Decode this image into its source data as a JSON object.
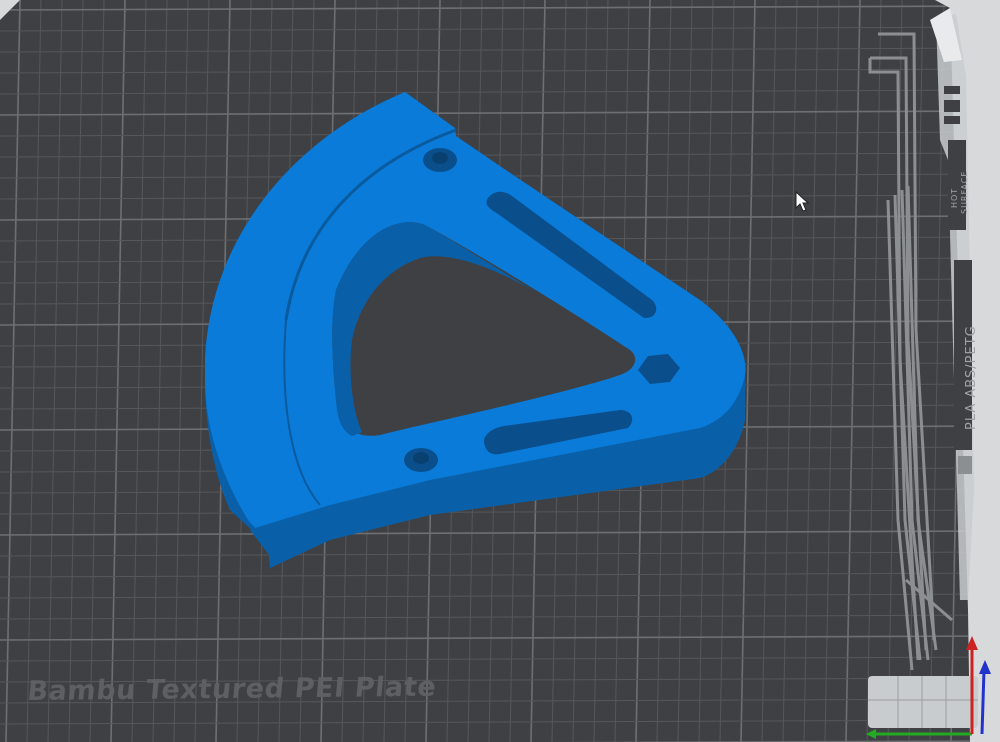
{
  "bed": {
    "plate_name": "Bambu Textured PEI Plate",
    "filament_label": "PLA ABS/PETG",
    "surface_label_1": "HOT",
    "surface_label_2": "SURFACE"
  },
  "model": {
    "color": "#0a7bd8",
    "side_color": "#0a60a8"
  },
  "colors": {
    "background": "#d7d9db",
    "bed": "#3f4043",
    "grid_major": "#6d6f72",
    "grid_minor": "#55575a",
    "axis_x": "#22aa22",
    "axis_y": "#cc2222",
    "axis_z": "#2233cc"
  },
  "icons": {
    "cursor": "mouse-pointer-icon",
    "axes": "axis-gizmo-icon"
  }
}
